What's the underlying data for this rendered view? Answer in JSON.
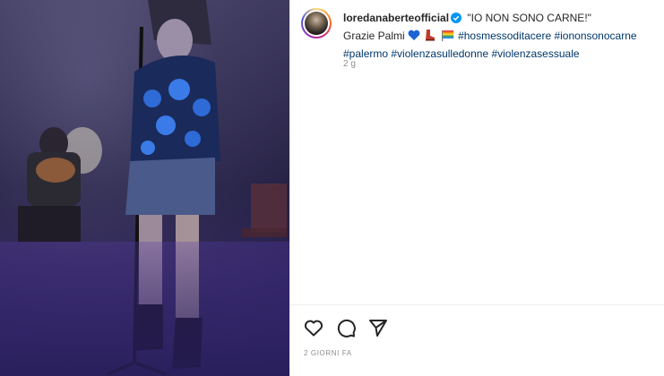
{
  "post": {
    "media_alt": "performer on stage",
    "username": "loredanaberteofficial",
    "caption_title": "\"IO NON SONO CARNE!\"",
    "caption_thanks": "Grazie Palmi",
    "hashtags": [
      "#hosmessoditacere",
      "#iononsonocarne",
      "#palermo",
      "#violenzasulledonne",
      "#violenzasessuale"
    ],
    "comment_age": "2 g",
    "posted_ago": "2 GIORNI FA"
  },
  "icons": {
    "verified": "verified-badge-icon",
    "heart_emoji": "blue-heart-emoji",
    "boot_emoji": "red-boot-emoji",
    "flag_emoji": "rainbow-flag-emoji",
    "like": "heart-icon",
    "comment": "comment-icon",
    "share": "paper-plane-icon"
  },
  "colors": {
    "link": "#00376b",
    "verified": "#0095f6",
    "muted": "#8e8e8e"
  }
}
